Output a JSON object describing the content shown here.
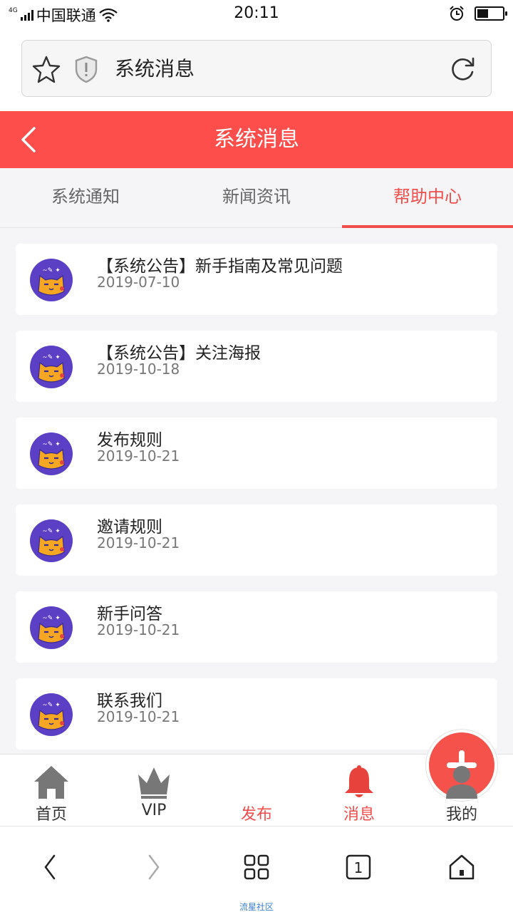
{
  "status_bar": {
    "network": "4G",
    "carrier": "中国联通",
    "time": "20:11",
    "battery_level": 0.45
  },
  "browser": {
    "page_title": "系统消息"
  },
  "header": {
    "title": "系统消息"
  },
  "tabs": [
    {
      "label": "系统通知",
      "active": false
    },
    {
      "label": "新闻资讯",
      "active": false
    },
    {
      "label": "帮助中心",
      "active": true
    }
  ],
  "messages": [
    {
      "title": "【系统公告】新手指南及常见问题",
      "date": "2019-07-10"
    },
    {
      "title": "【系统公告】关注海报",
      "date": "2019-10-18"
    },
    {
      "title": "发布规则",
      "date": "2019-10-21"
    },
    {
      "title": "邀请规则",
      "date": "2019-10-21"
    },
    {
      "title": "新手问答",
      "date": "2019-10-21"
    },
    {
      "title": "联系我们",
      "date": "2019-10-21"
    }
  ],
  "bottom_nav": {
    "home": "首页",
    "vip": "VIP",
    "publish": "发布",
    "messages": "消息",
    "mine": "我的"
  },
  "browser_nav": {
    "tab_count": "1",
    "footer": "流星社区"
  },
  "colors": {
    "accent": "#fd4e4b",
    "tab_active": "#f04d4b",
    "page_bg": "#f5f5f7",
    "avatar_bg": "#5b3fc4",
    "avatar_face": "#f5a623"
  }
}
